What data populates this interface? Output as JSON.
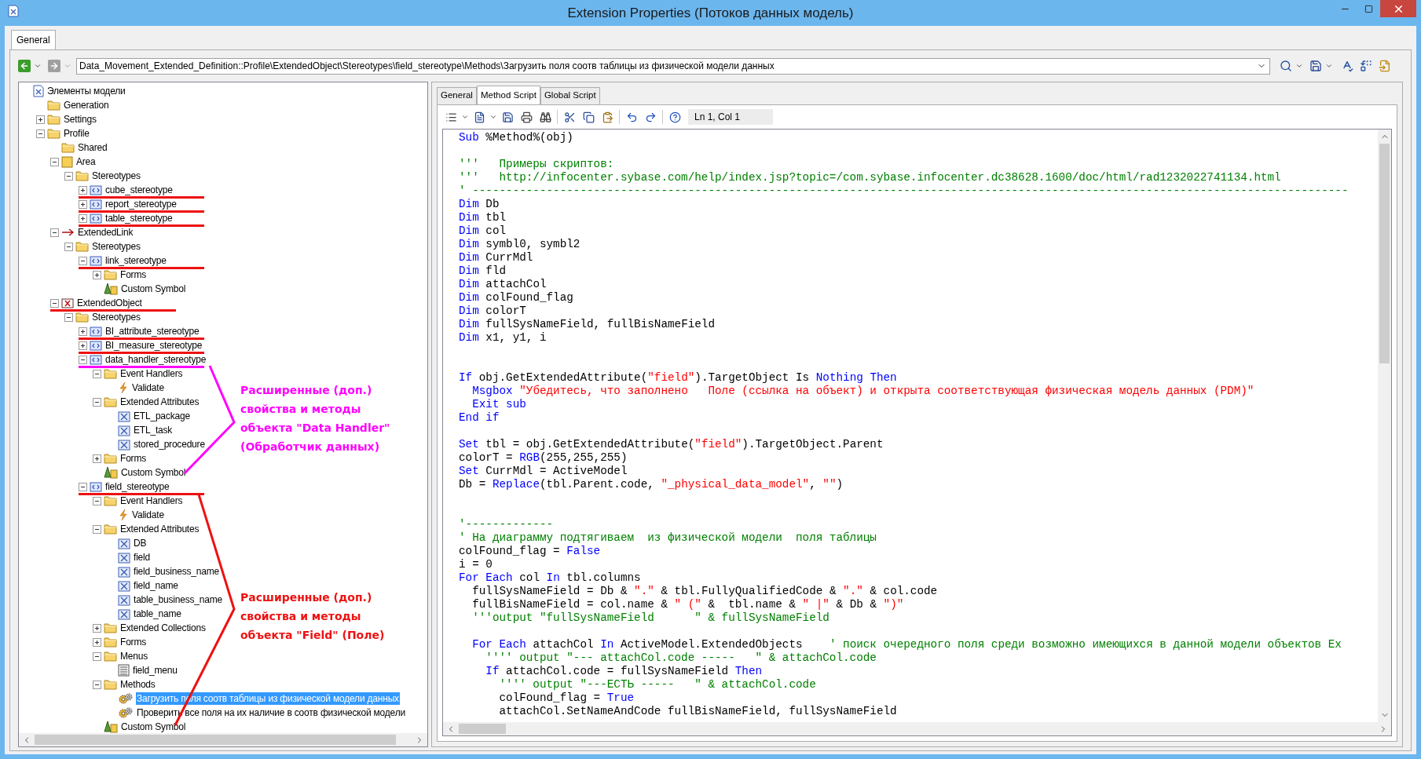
{
  "window": {
    "title": "Extension Properties (Потоков данных модель)"
  },
  "outer_tabs": [
    {
      "label": "General",
      "selected": true
    }
  ],
  "path": {
    "value": "Data_Movement_Extended_Definition::Profile\\ExtendedObject\\Stereotypes\\field_stereotype\\Methods\\Загрузить поля соотв таблицы из физической модели данных"
  },
  "tree": [
    {
      "label": "Элементы модели",
      "kind": "model",
      "selected": false,
      "children": [
        {
          "label": "Generation",
          "kind": "folder",
          "selected": false
        },
        {
          "label": "Settings",
          "kind": "folder",
          "expanded": false,
          "selected": false
        },
        {
          "label": "Profile",
          "kind": "folder",
          "expanded": true,
          "selected": false,
          "children": [
            {
              "label": "Shared",
              "kind": "folder",
              "selected": false
            },
            {
              "label": "Area",
              "kind": "area",
              "expanded": true,
              "selected": false,
              "children": [
                {
                  "label": "Stereotypes",
                  "kind": "folder",
                  "expanded": true,
                  "selected": false,
                  "children": [
                    {
                      "label": "cube_stereotype",
                      "kind": "stereotype",
                      "expanded": false,
                      "selected": false,
                      "color": "#ee1111"
                    },
                    {
                      "label": "report_stereotype",
                      "kind": "stereotype",
                      "expanded": false,
                      "selected": false,
                      "color": "#ee1111"
                    },
                    {
                      "label": "table_stereotype",
                      "kind": "stereotype",
                      "expanded": false,
                      "selected": false,
                      "color": "#ee1111"
                    }
                  ]
                }
              ]
            },
            {
              "label": "ExtendedLink",
              "kind": "link",
              "expanded": true,
              "selected": false,
              "children": [
                {
                  "label": "Stereotypes",
                  "kind": "folder",
                  "expanded": true,
                  "selected": false,
                  "children": [
                    {
                      "label": "link_stereotype",
                      "kind": "stereotype",
                      "expanded": true,
                      "selected": false,
                      "color": "#ee1111",
                      "children": [
                        {
                          "label": "Forms",
                          "kind": "folder",
                          "expanded": false,
                          "selected": false
                        },
                        {
                          "label": "Custom Symbol",
                          "kind": "symbol",
                          "selected": false
                        }
                      ]
                    }
                  ]
                }
              ]
            },
            {
              "label": "ExtendedObject",
              "kind": "object",
              "expanded": true,
              "selected": false,
              "color": "#ee1111",
              "children": [
                {
                  "label": "Stereotypes",
                  "kind": "folder",
                  "expanded": true,
                  "selected": false,
                  "children": [
                    {
                      "label": "BI_attribute_stereotype",
                      "kind": "stereotype",
                      "expanded": false,
                      "selected": false,
                      "color": "#ee1111"
                    },
                    {
                      "label": "BI_measure_stereotype",
                      "kind": "stereotype",
                      "expanded": false,
                      "selected": false,
                      "color": "#ee1111"
                    },
                    {
                      "label": "data_handler_stereotype",
                      "kind": "stereotype",
                      "expanded": true,
                      "selected": false,
                      "color": "#ff00ff",
                      "children": [
                        {
                          "label": "Event Handlers",
                          "kind": "folder",
                          "expanded": true,
                          "selected": false,
                          "children": [
                            {
                              "label": "Validate",
                              "kind": "event",
                              "selected": false
                            }
                          ]
                        },
                        {
                          "label": "Extended Attributes",
                          "kind": "folder",
                          "expanded": true,
                          "selected": false,
                          "children": [
                            {
                              "label": "ETL_package",
                              "kind": "attribute",
                              "selected": false
                            },
                            {
                              "label": "ETL_task",
                              "kind": "attribute",
                              "selected": false
                            },
                            {
                              "label": "stored_procedure",
                              "kind": "attribute",
                              "selected": false
                            }
                          ]
                        },
                        {
                          "label": "Forms",
                          "kind": "folder",
                          "expanded": false,
                          "selected": false
                        },
                        {
                          "label": "Custom Symbol",
                          "kind": "symbol",
                          "selected": false
                        }
                      ]
                    },
                    {
                      "label": "field_stereotype",
                      "kind": "stereotype",
                      "expanded": true,
                      "selected": false,
                      "color": "#ee1111",
                      "children": [
                        {
                          "label": "Event Handlers",
                          "kind": "folder",
                          "expanded": true,
                          "selected": false,
                          "children": [
                            {
                              "label": "Validate",
                              "kind": "event",
                              "selected": false
                            }
                          ]
                        },
                        {
                          "label": "Extended Attributes",
                          "kind": "folder",
                          "expanded": true,
                          "selected": false,
                          "children": [
                            {
                              "label": "DB",
                              "kind": "attribute",
                              "selected": false
                            },
                            {
                              "label": "field",
                              "kind": "attribute",
                              "selected": false
                            },
                            {
                              "label": "field_business_name",
                              "kind": "attribute",
                              "selected": false
                            },
                            {
                              "label": "field_name",
                              "kind": "attribute",
                              "selected": false
                            },
                            {
                              "label": "table_business_name",
                              "kind": "attribute",
                              "selected": false
                            },
                            {
                              "label": "table_name",
                              "kind": "attribute",
                              "selected": false
                            }
                          ]
                        },
                        {
                          "label": "Extended Collections",
                          "kind": "folder",
                          "expanded": false,
                          "selected": false
                        },
                        {
                          "label": "Forms",
                          "kind": "folder",
                          "expanded": false,
                          "selected": false
                        },
                        {
                          "label": "Menus",
                          "kind": "folder",
                          "expanded": true,
                          "selected": false,
                          "children": [
                            {
                              "label": "field_menu",
                              "kind": "menu",
                              "selected": false
                            }
                          ]
                        },
                        {
                          "label": "Methods",
                          "kind": "folder",
                          "expanded": true,
                          "selected": false,
                          "children": [
                            {
                              "label": "Загрузить поля соотв таблицы из физической модели данных",
                              "kind": "method",
                              "selected": true
                            },
                            {
                              "label": "Проверить все поля на их наличие в соотв физической модели",
                              "kind": "method",
                              "selected": false
                            }
                          ]
                        },
                        {
                          "label": "Custom Symbol",
                          "kind": "symbol",
                          "selected": false
                        }
                      ]
                    }
                  ]
                }
              ]
            }
          ]
        }
      ]
    }
  ],
  "annotations": [
    {
      "color": "#ff00ff",
      "lines": [
        "Расширенные (доп.)",
        "свойства и методы",
        "объекта \"Data Handler\"",
        "(Обработчик данных)"
      ]
    },
    {
      "color": "#ee1111",
      "lines": [
        "Расширенные (доп.)",
        "свойства и методы",
        "объекта \"Field\" (Поле)"
      ]
    }
  ],
  "inner_tabs": [
    {
      "label": "General",
      "selected": false
    },
    {
      "label": "Method Script",
      "selected": true
    },
    {
      "label": "Global Script",
      "selected": false
    }
  ],
  "cursor_position": "Ln 1, Col 1",
  "code_lines": [
    {
      "kind": "code",
      "segments": [
        {
          "kind": "keyword",
          "text": "Sub"
        },
        {
          "kind": "plain",
          "text": " %Method%(obj)"
        }
      ]
    },
    {
      "kind": "blank"
    },
    {
      "kind": "code",
      "segments": [
        {
          "kind": "comment",
          "text": "'''   Примеры скриптов:"
        }
      ]
    },
    {
      "kind": "code",
      "segments": [
        {
          "kind": "comment",
          "text": "'''   http://infocenter.sybase.com/help/index.jsp?topic=/com.sybase.infocenter.dc38628.1600/doc/html/rad1232022741134.html"
        }
      ]
    },
    {
      "kind": "code",
      "segments": [
        {
          "kind": "comment",
          "text": "' ----------------------------------------------------------------------------------------------------------------------------------"
        }
      ]
    },
    {
      "kind": "code",
      "segments": [
        {
          "kind": "keyword",
          "text": "Dim"
        },
        {
          "kind": "plain",
          "text": " Db"
        }
      ]
    },
    {
      "kind": "code",
      "segments": [
        {
          "kind": "keyword",
          "text": "Dim"
        },
        {
          "kind": "plain",
          "text": " tbl"
        }
      ]
    },
    {
      "kind": "code",
      "segments": [
        {
          "kind": "keyword",
          "text": "Dim"
        },
        {
          "kind": "plain",
          "text": " col"
        }
      ]
    },
    {
      "kind": "code",
      "segments": [
        {
          "kind": "keyword",
          "text": "Dim"
        },
        {
          "kind": "plain",
          "text": " symbl0, symbl2"
        }
      ]
    },
    {
      "kind": "code",
      "segments": [
        {
          "kind": "keyword",
          "text": "Dim"
        },
        {
          "kind": "plain",
          "text": " CurrMdl"
        }
      ]
    },
    {
      "kind": "code",
      "segments": [
        {
          "kind": "keyword",
          "text": "Dim"
        },
        {
          "kind": "plain",
          "text": " fld"
        }
      ]
    },
    {
      "kind": "code",
      "segments": [
        {
          "kind": "keyword",
          "text": "Dim"
        },
        {
          "kind": "plain",
          "text": " attachCol"
        }
      ]
    },
    {
      "kind": "code",
      "segments": [
        {
          "kind": "keyword",
          "text": "Dim"
        },
        {
          "kind": "plain",
          "text": " colFound_flag"
        }
      ]
    },
    {
      "kind": "code",
      "segments": [
        {
          "kind": "keyword",
          "text": "Dim"
        },
        {
          "kind": "plain",
          "text": " colorT"
        }
      ]
    },
    {
      "kind": "code",
      "segments": [
        {
          "kind": "keyword",
          "text": "Dim"
        },
        {
          "kind": "plain",
          "text": " fullSysNameField, fullBisNameField"
        }
      ]
    },
    {
      "kind": "code",
      "segments": [
        {
          "kind": "keyword",
          "text": "Dim"
        },
        {
          "kind": "plain",
          "text": " x1, y1, i"
        }
      ]
    },
    {
      "kind": "blank"
    },
    {
      "kind": "blank"
    },
    {
      "kind": "code",
      "segments": [
        {
          "kind": "keyword",
          "text": "If"
        },
        {
          "kind": "plain",
          "text": " obj.GetExtendedAttribute("
        },
        {
          "kind": "string",
          "text": "\"field\""
        },
        {
          "kind": "plain",
          "text": ").TargetObject Is "
        },
        {
          "kind": "keyword",
          "text": "Nothing Then"
        }
      ]
    },
    {
      "kind": "code",
      "segments": [
        {
          "kind": "keyword",
          "text": "  Msgbox"
        },
        {
          "kind": "string",
          "text": " \"Убедитесь, что заполнено   Поле (ссылка на объект) и открыта соответствующая физическая модель данных (PDM)\""
        }
      ]
    },
    {
      "kind": "code",
      "segments": [
        {
          "kind": "keyword",
          "text": "  Exit sub"
        }
      ]
    },
    {
      "kind": "code",
      "segments": [
        {
          "kind": "keyword",
          "text": "End if"
        }
      ]
    },
    {
      "kind": "blank"
    },
    {
      "kind": "code",
      "segments": [
        {
          "kind": "keyword",
          "text": "Set"
        },
        {
          "kind": "plain",
          "text": " tbl = obj.GetExtendedAttribute("
        },
        {
          "kind": "string",
          "text": "\"field\""
        },
        {
          "kind": "plain",
          "text": ").TargetObject.Parent"
        }
      ]
    },
    {
      "kind": "code",
      "segments": [
        {
          "kind": "plain",
          "text": "colorT = "
        },
        {
          "kind": "keyword",
          "text": "RGB"
        },
        {
          "kind": "plain",
          "text": "(255,255,255)"
        }
      ]
    },
    {
      "kind": "code",
      "segments": [
        {
          "kind": "keyword",
          "text": "Set"
        },
        {
          "kind": "plain",
          "text": " CurrMdl = ActiveModel"
        }
      ]
    },
    {
      "kind": "code",
      "segments": [
        {
          "kind": "plain",
          "text": "Db = "
        },
        {
          "kind": "keyword",
          "text": "Replace"
        },
        {
          "kind": "plain",
          "text": "(tbl.Parent.code, "
        },
        {
          "kind": "string",
          "text": "\"_physical_data_model\""
        },
        {
          "kind": "plain",
          "text": ", "
        },
        {
          "kind": "string",
          "text": "\"\""
        },
        {
          "kind": "plain",
          "text": ")"
        }
      ]
    },
    {
      "kind": "blank"
    },
    {
      "kind": "blank"
    },
    {
      "kind": "code",
      "segments": [
        {
          "kind": "comment",
          "text": "'-------------"
        }
      ]
    },
    {
      "kind": "code",
      "segments": [
        {
          "kind": "comment",
          "text": "' На диаграмму подтягиваем  из физической модели  поля таблицы"
        }
      ]
    },
    {
      "kind": "code",
      "segments": [
        {
          "kind": "plain",
          "text": "colFound_flag = "
        },
        {
          "kind": "keyword",
          "text": "False"
        }
      ]
    },
    {
      "kind": "code",
      "segments": [
        {
          "kind": "plain",
          "text": "i = 0"
        }
      ]
    },
    {
      "kind": "code",
      "segments": [
        {
          "kind": "keyword",
          "text": "For Each"
        },
        {
          "kind": "plain",
          "text": " col "
        },
        {
          "kind": "keyword",
          "text": "In"
        },
        {
          "kind": "plain",
          "text": " tbl.columns"
        }
      ]
    },
    {
      "kind": "code",
      "segments": [
        {
          "kind": "plain",
          "text": "  fullSysNameField = Db & "
        },
        {
          "kind": "string",
          "text": "\".\""
        },
        {
          "kind": "plain",
          "text": " & tbl.FullyQualifiedCode & "
        },
        {
          "kind": "string",
          "text": "\".\""
        },
        {
          "kind": "plain",
          "text": " & col.code"
        }
      ]
    },
    {
      "kind": "code",
      "segments": [
        {
          "kind": "plain",
          "text": "  fullBisNameField = col.name & "
        },
        {
          "kind": "string",
          "text": "\" (\""
        },
        {
          "kind": "plain",
          "text": " &  tbl.name & "
        },
        {
          "kind": "string",
          "text": "\" |\""
        },
        {
          "kind": "plain",
          "text": " & Db & "
        },
        {
          "kind": "string",
          "text": "\")\""
        }
      ]
    },
    {
      "kind": "code",
      "segments": [
        {
          "kind": "comment",
          "text": "  '''output \"fullSysNameField      \" & fullSysNameField"
        }
      ]
    },
    {
      "kind": "blank"
    },
    {
      "kind": "code",
      "segments": [
        {
          "kind": "keyword",
          "text": "  For Each"
        },
        {
          "kind": "plain",
          "text": " attachCol "
        },
        {
          "kind": "keyword",
          "text": "In"
        },
        {
          "kind": "plain",
          "text": " ActiveModel.ExtendedObjects    "
        },
        {
          "kind": "comment",
          "text": "' поиск очередного поля среди возможно имеющихся в данной модели объектов Ex"
        }
      ]
    },
    {
      "kind": "code",
      "segments": [
        {
          "kind": "comment",
          "text": "    '''' output \"--- attachCol.code -----   \" & attachCol.code"
        }
      ]
    },
    {
      "kind": "code",
      "segments": [
        {
          "kind": "keyword",
          "text": "    If"
        },
        {
          "kind": "plain",
          "text": " attachCol.code = fullSysNameField "
        },
        {
          "kind": "keyword",
          "text": "Then"
        }
      ]
    },
    {
      "kind": "code",
      "segments": [
        {
          "kind": "comment",
          "text": "      '''' output \"---ЕСТЬ -----   \" & attachCol.code"
        }
      ]
    },
    {
      "kind": "code",
      "segments": [
        {
          "kind": "plain",
          "text": "      colFound_flag = "
        },
        {
          "kind": "keyword",
          "text": "True"
        }
      ]
    },
    {
      "kind": "code",
      "segments": [
        {
          "kind": "plain",
          "text": "      attachCol.SetNameAndCode fullBisNameField, fullSysNameField"
        }
      ]
    }
  ]
}
